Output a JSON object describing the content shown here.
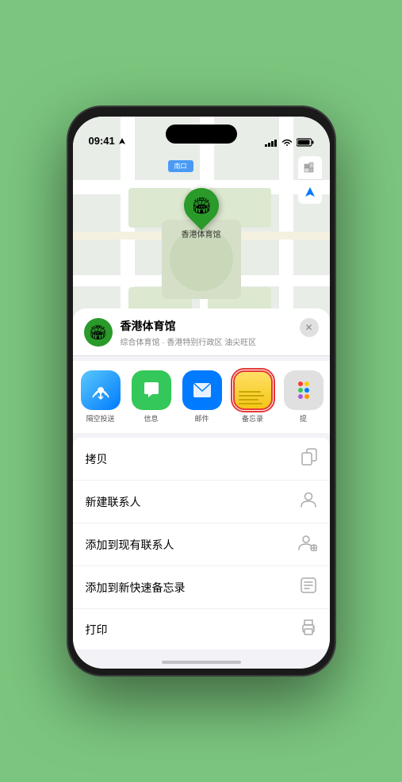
{
  "statusBar": {
    "time": "09:41",
    "locationIcon": "▶",
    "signal": "▌▌▌",
    "wifi": "WiFi",
    "battery": "🔋"
  },
  "map": {
    "locationLabel": "南口",
    "pinLabel": "香港体育馆",
    "mapType": "standard",
    "locationArrow": "➤"
  },
  "infoCard": {
    "venueName": "香港体育馆",
    "venueSubtitle": "综合体育馆 · 香港特别行政区 油尖旺区",
    "closeButtonLabel": "✕"
  },
  "shareRow": {
    "items": [
      {
        "id": "airdrop",
        "label": "隔空投送",
        "icon": "📡"
      },
      {
        "id": "messages",
        "label": "信息",
        "icon": "💬"
      },
      {
        "id": "mail",
        "label": "邮件",
        "icon": "✉️"
      },
      {
        "id": "notes",
        "label": "备忘录",
        "icon": "📝",
        "selected": true
      },
      {
        "id": "more",
        "label": "提",
        "icon": "···"
      }
    ]
  },
  "actionRows": [
    {
      "id": "copy",
      "label": "拷贝",
      "icon": "copy"
    },
    {
      "id": "new-contact",
      "label": "新建联系人",
      "icon": "person"
    },
    {
      "id": "add-contact",
      "label": "添加到现有联系人",
      "icon": "person-add"
    },
    {
      "id": "quick-note",
      "label": "添加到新快速备忘录",
      "icon": "note"
    },
    {
      "id": "print",
      "label": "打印",
      "icon": "print"
    }
  ]
}
